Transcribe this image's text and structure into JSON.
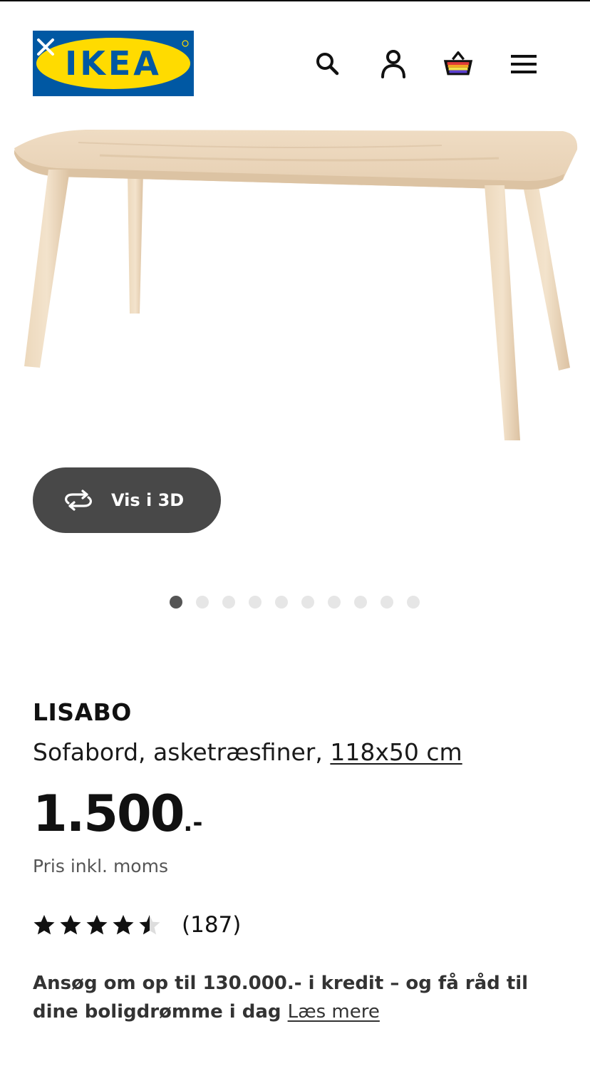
{
  "header": {
    "logo_text": "IKEA",
    "brand_colors": {
      "blue": "#0058a3",
      "yellow": "#ffdb00"
    },
    "icons": [
      "close-icon",
      "search-icon",
      "user-icon",
      "basket-icon",
      "menu-icon"
    ]
  },
  "media": {
    "view3d_label": "Vis i 3D",
    "view3d_icon": "rotate-3d-icon",
    "image_count": 10,
    "active_image_index": 0
  },
  "product": {
    "name": "LISABO",
    "description": "Sofabord, asketræsfiner,",
    "size": "118x50 cm",
    "price": "1.500",
    "price_suffix": ".-",
    "price_note": "Pris inkl. moms",
    "rating": 4.5,
    "rating_max": 5,
    "review_count": "(187)"
  },
  "promo": {
    "text": "Ansøg om op til 130.000.- i kredit – og få råd til dine boligdrømme i dag",
    "link": "Læs mere"
  }
}
